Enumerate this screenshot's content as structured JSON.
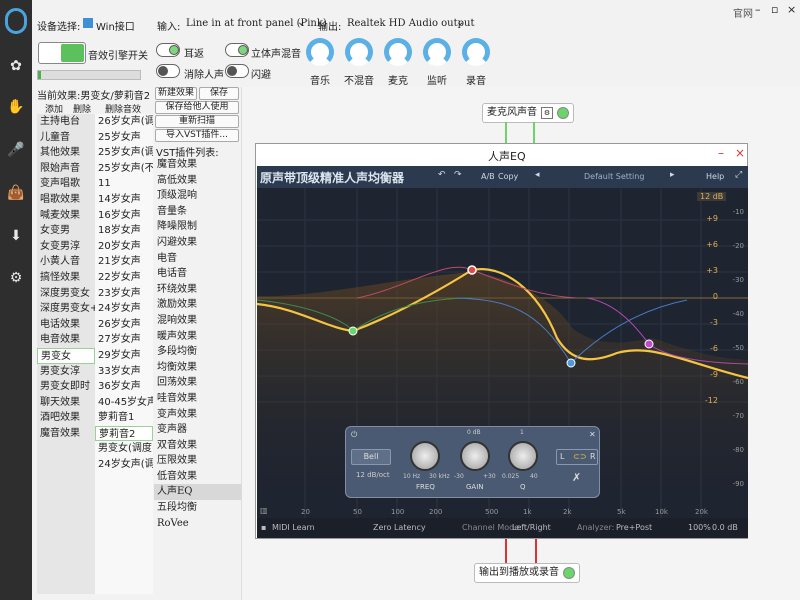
{
  "top": {
    "device_label": "设备选择:",
    "device_value": "Win接口",
    "input_label": "输入:",
    "input_value": "Line in at front panel (Pink)",
    "output_label": "输出:",
    "output_value": "Realtek HD Audio output",
    "official_label": "官网",
    "engine_label": "音效引擎开关",
    "current_effect": "当前效果:男变女/萝莉音2",
    "add_label": "添加",
    "delete_label": "删除",
    "delete_all_label": "删除音效"
  },
  "toggles": {
    "ear_return": "耳返",
    "stereo_mix": "立体声混音",
    "noise_remove": "消除人声",
    "dodge": "闪避"
  },
  "knobs": [
    "音乐",
    "不混音",
    "麦克",
    "监听",
    "录音"
  ],
  "effects_col1": [
    "主持电台",
    "儿童音",
    "其他效果",
    "限始声音",
    "变声唱歌",
    "唱歌效果",
    "喊麦效果",
    "女变男",
    "女变男淳",
    "小黄人音",
    "搞怪效果",
    "深度男变女",
    "深度男变女+混响",
    "电话效果",
    "电音效果",
    "男变女",
    "男变女淳",
    "男变女即时",
    "聊天效果",
    "酒吧效果",
    "魔音效果"
  ],
  "effects_col2": [
    "26岁女声(调整后)",
    "25岁女声",
    "25岁女声(调整后)",
    "25岁女声(不加...",
    "11",
    "14岁女声",
    "16岁女声",
    "18岁女声",
    "20岁女声",
    "21岁女声",
    "22岁女声",
    "23岁女声",
    "24岁女声",
    "26岁女声",
    "27岁女声",
    "29岁女声",
    "33岁女声",
    "36岁女声",
    "40-45岁女声",
    "萝莉音1",
    "萝莉音2",
    "男变女(调度+...",
    "24岁女声(调整后)"
  ],
  "vst": {
    "new_effect": "新建效果",
    "save": "保存",
    "save_for_others": "保存给他人使用",
    "rescan": "重新扫描",
    "import_vst": "导入VST插件...",
    "list_title": "VST插件列表:",
    "plugins": [
      "魔音效果",
      "高低效果",
      "顶级混响",
      "音量条",
      "降噪限制",
      "闪避效果",
      "电音",
      "电话音",
      "环绕效果",
      "激励效果",
      "混响效果",
      "暖声效果",
      "多段均衡",
      "均衡效果",
      "回荡效果",
      "哇音效果",
      "变声效果",
      "变声器",
      "双音效果",
      "压限效果",
      "低音效果",
      "人声EQ",
      "五段均衡",
      "RoVee"
    ]
  },
  "nodes": {
    "mic_node": "麦克风声音",
    "output_node": "输出到播放或录音"
  },
  "eq_window": {
    "title": "人声EQ",
    "banner_title": "原声带顶级精准人声均衡器",
    "ab": "A/B",
    "copy": "Copy",
    "preset": "Default Setting",
    "help": "Help",
    "gain_top": "12 dB",
    "scale_right": [
      "+9",
      "+6",
      "+3",
      "0",
      "-3",
      "-6",
      "-9",
      "-12"
    ],
    "scale_right2": [
      "-10",
      "-20",
      "-30",
      "-40",
      "-50",
      "-60",
      "-70",
      "-80",
      "-90"
    ],
    "freqs": [
      "20",
      "50",
      "100",
      "200",
      "500",
      "1k",
      "2k",
      "5k",
      "10k",
      "20k"
    ],
    "band": {
      "type": "Bell",
      "slope": "12 dB/oct",
      "freq_label": "FREQ",
      "gain_label": "GAIN",
      "q_label": "Q",
      "freq_min": "10 Hz",
      "freq_max": "30 kHz",
      "gain_min": "-30",
      "gain_max": "+30",
      "gain_center": "0 dB",
      "q_min": "0.025",
      "q_max": "40",
      "q_center": "1",
      "l": "L",
      "r": "R"
    },
    "footer": {
      "midi": "MIDI Learn",
      "latency": "Zero Latency",
      "channel_label": "Channel Mode:",
      "channel_value": "Left/Right",
      "analyzer_label": "Analyzer:",
      "analyzer_value": "Pre+Post",
      "zoom": "100%",
      "gain": "0.0 dB"
    }
  },
  "colors": {
    "accent": "#5bb0e6",
    "green": "#6ad66a",
    "curve": "#f5c542",
    "sidebar": "#2e2e2e"
  }
}
